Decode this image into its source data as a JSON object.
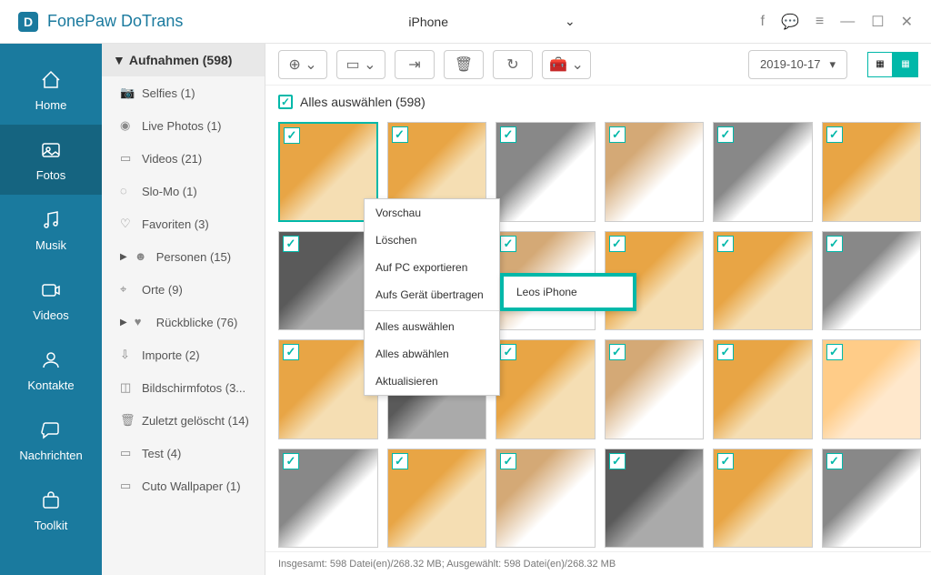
{
  "app": {
    "title": "FonePaw DoTrans"
  },
  "device": {
    "name": "iPhone"
  },
  "nav": {
    "home": "Home",
    "fotos": "Fotos",
    "musik": "Musik",
    "videos": "Videos",
    "kontakte": "Kontakte",
    "nachrichten": "Nachrichten",
    "toolkit": "Toolkit"
  },
  "sidebar": {
    "header": "Aufnahmen (598)",
    "items": [
      {
        "label": "Selfies (1)"
      },
      {
        "label": "Live Photos (1)"
      },
      {
        "label": "Videos (21)"
      },
      {
        "label": "Slo-Mo (1)"
      },
      {
        "label": "Favoriten (3)"
      },
      {
        "label": "Personen (15)"
      },
      {
        "label": "Orte (9)"
      },
      {
        "label": "Rückblicke (76)"
      },
      {
        "label": "Importe (2)"
      },
      {
        "label": "Bildschirmfotos (3..."
      },
      {
        "label": "Zuletzt gelöscht (14)"
      },
      {
        "label": "Test (4)"
      },
      {
        "label": "Cuto Wallpaper (1)"
      }
    ]
  },
  "selectAll": "Alles auswählen (598)",
  "date": "2019-10-17",
  "context": {
    "preview": "Vorschau",
    "delete": "Löschen",
    "exportPC": "Auf PC exportieren",
    "transfer": "Aufs Gerät übertragen",
    "selectAll": "Alles auswählen",
    "deselectAll": "Alles abwählen",
    "refresh": "Aktualisieren"
  },
  "submenu": {
    "device": "Leos iPhone"
  },
  "status": "Insgesamt: 598 Datei(en)/268.32 MB; Ausgewählt: 598 Datei(en)/268.32 MB"
}
